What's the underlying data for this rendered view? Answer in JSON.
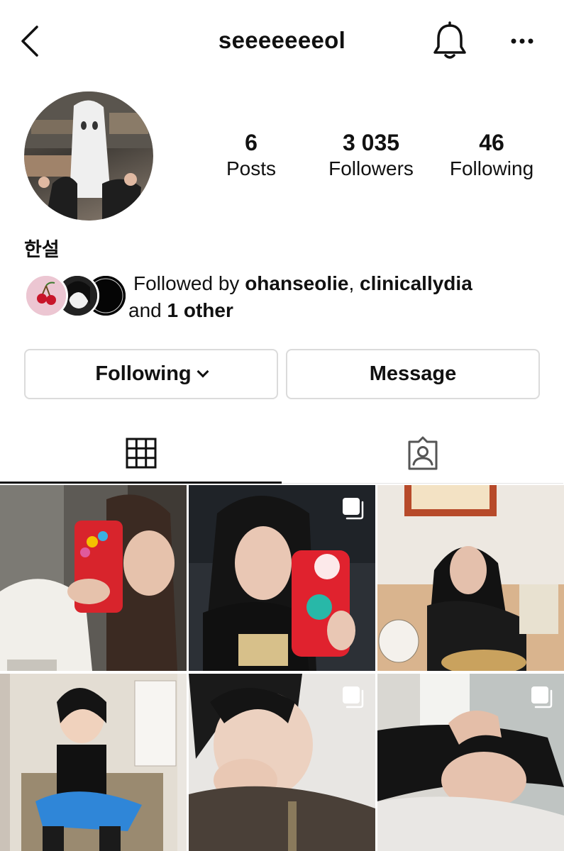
{
  "header": {
    "username": "seeeeeeeol",
    "back_icon": "chevron-left-icon",
    "bell_icon": "bell-icon",
    "more_icon": "more-horizontal-icon"
  },
  "profile": {
    "full_name": "한설",
    "stats": [
      {
        "value": "6",
        "label": "Posts"
      },
      {
        "value": "3 035",
        "label": "Followers"
      },
      {
        "value": "46",
        "label": "Following"
      }
    ],
    "followed_by": {
      "prefix": "Followed by ",
      "user1": "ohanseolie",
      "separator": ", ",
      "user2": "clinicallydia",
      "and": " and ",
      "others": "1 other"
    }
  },
  "actions": {
    "following_label": "Following",
    "message_label": "Message"
  },
  "tabs": [
    {
      "name": "posts-grid",
      "icon": "grid-icon",
      "active": true
    },
    {
      "name": "tagged",
      "icon": "tagged-person-icon",
      "active": false
    }
  ],
  "posts": [
    {
      "id": "post-1",
      "multi": false
    },
    {
      "id": "post-2",
      "multi": true
    },
    {
      "id": "post-3",
      "multi": false
    },
    {
      "id": "post-4",
      "multi": false
    },
    {
      "id": "post-5",
      "multi": true
    },
    {
      "id": "post-6",
      "multi": true
    }
  ],
  "colors": {
    "border": "#dbdbdb",
    "text": "#111111",
    "background": "#ffffff"
  }
}
